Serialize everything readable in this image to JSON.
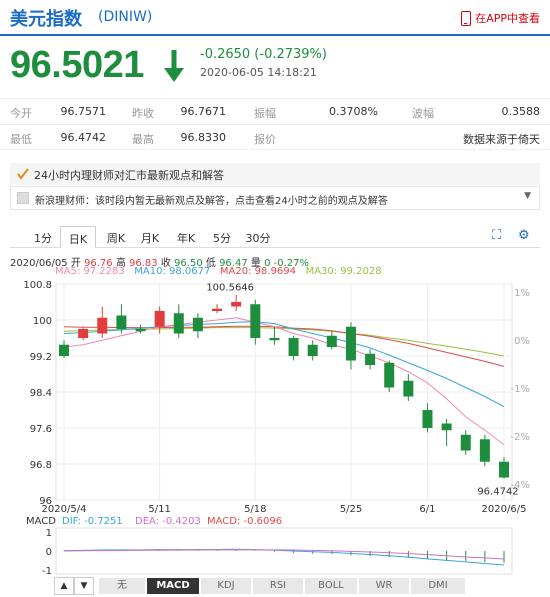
{
  "header": {
    "title": "美元指数",
    "code": "(DINIW)",
    "app_link": "在APP中查看"
  },
  "quote": {
    "price": "96.5021",
    "change": "-0.2650 (-0.2739%)",
    "time": "2020-06-05 14:18:21",
    "direction": "down",
    "color": "#1e8e3e"
  },
  "stats": {
    "rows": [
      [
        {
          "label": "今开",
          "value": "96.7571"
        },
        {
          "label": "昨收",
          "value": "96.7671"
        },
        {
          "label": "振幅",
          "value": "0.3708%"
        },
        {
          "label": "波幅",
          "value": "0.3588"
        }
      ],
      [
        {
          "label": "最低",
          "value": "96.4742"
        },
        {
          "label": "最高",
          "value": "96.8330"
        },
        {
          "label": "报价",
          "value": "数据来源于倚天"
        },
        {
          "label": "",
          "value": ""
        }
      ]
    ]
  },
  "info": {
    "title": "24小时内理财师对汇市最新观点和解答",
    "notice": "新浪理财师：该时段内暂无最新观点及解答，点击查看24小时之前的观点及解答"
  },
  "tabs": [
    "1分",
    "日K",
    "周K",
    "月K",
    "年K",
    "5分",
    "30分"
  ],
  "active_tab": "日K",
  "ohlc": {
    "date": "2020/06/05",
    "open_label": "开",
    "open": "96.76",
    "high_label": "高",
    "high": "96.83",
    "close_label": "收",
    "close": "96.50",
    "low_label": "低",
    "low": "96.47",
    "chg_label": "量",
    "chg": "0 -0.27%"
  },
  "ma": [
    {
      "label": "MA5: 97.2283",
      "color": "#f088b4"
    },
    {
      "label": "MA10: 98.0677",
      "color": "#3aa6d8"
    },
    {
      "label": "MA20: 98.9694",
      "color": "#e04a4a"
    },
    {
      "label": "MA30: 99.2028",
      "color": "#9ac23c"
    }
  ],
  "chart_data": {
    "type": "candlestick",
    "ylim": [
      96,
      100.8
    ],
    "y_ticks": [
      "100.8",
      "100",
      "99.2",
      "98.4",
      "97.6",
      "96.8",
      "96"
    ],
    "right_ticks": [
      "1%",
      "0%",
      "-1%",
      "-2%",
      "-4%"
    ],
    "x_labels": [
      {
        "index": 0,
        "label": "2020/5/4"
      },
      {
        "index": 5,
        "label": "5/11"
      },
      {
        "index": 10,
        "label": "5/18"
      },
      {
        "index": 15,
        "label": "5/25"
      },
      {
        "index": 19,
        "label": "6/1"
      },
      {
        "index": 23,
        "label": "2020/6/5"
      }
    ],
    "candles": [
      {
        "o": 99.45,
        "h": 99.55,
        "c": 99.2,
        "l": 99.15
      },
      {
        "o": 99.6,
        "h": 99.85,
        "c": 99.8,
        "l": 99.55
      },
      {
        "o": 99.7,
        "h": 100.3,
        "c": 100.05,
        "l": 99.6
      },
      {
        "o": 100.1,
        "h": 100.35,
        "c": 99.8,
        "l": 99.7
      },
      {
        "o": 99.8,
        "h": 99.9,
        "c": 99.75,
        "l": 99.7
      },
      {
        "o": 99.85,
        "h": 100.3,
        "c": 100.2,
        "l": 99.7
      },
      {
        "o": 100.15,
        "h": 100.35,
        "c": 99.7,
        "l": 99.6
      },
      {
        "o": 100.05,
        "h": 100.15,
        "c": 99.75,
        "l": 99.6
      },
      {
        "o": 100.2,
        "h": 100.35,
        "c": 100.25,
        "l": 100.15
      },
      {
        "o": 100.3,
        "h": 100.56,
        "c": 100.4,
        "l": 100.2
      },
      {
        "o": 100.35,
        "h": 100.45,
        "c": 99.6,
        "l": 99.45
      },
      {
        "o": 99.6,
        "h": 99.85,
        "c": 99.55,
        "l": 99.45
      },
      {
        "o": 99.6,
        "h": 99.65,
        "c": 99.2,
        "l": 99.1
      },
      {
        "o": 99.45,
        "h": 99.55,
        "c": 99.2,
        "l": 99.1
      },
      {
        "o": 99.65,
        "h": 99.75,
        "c": 99.4,
        "l": 99.35
      },
      {
        "o": 99.85,
        "h": 99.95,
        "c": 99.1,
        "l": 98.9
      },
      {
        "o": 99.25,
        "h": 99.35,
        "c": 99.0,
        "l": 98.9
      },
      {
        "o": 99.05,
        "h": 99.1,
        "c": 98.5,
        "l": 98.4
      },
      {
        "o": 98.65,
        "h": 98.8,
        "c": 98.3,
        "l": 98.2
      },
      {
        "o": 98.0,
        "h": 98.15,
        "c": 97.6,
        "l": 97.5
      },
      {
        "o": 97.7,
        "h": 97.8,
        "c": 97.55,
        "l": 97.2
      },
      {
        "o": 97.45,
        "h": 97.55,
        "c": 97.1,
        "l": 97.0
      },
      {
        "o": 97.35,
        "h": 97.45,
        "c": 96.85,
        "l": 96.75
      },
      {
        "o": 96.85,
        "h": 96.95,
        "c": 96.5,
        "l": 96.47
      }
    ],
    "annotations": [
      {
        "index": 9,
        "value": 100.5646,
        "label": "100.5646"
      },
      {
        "index": 23,
        "value": 96.4742,
        "label": "96.4742"
      }
    ],
    "ma5": [
      99.4,
      99.45,
      99.55,
      99.65,
      99.75,
      99.85,
      99.9,
      99.95,
      100.0,
      100.05,
      99.95,
      99.85,
      99.7,
      99.6,
      99.45,
      99.35,
      99.2,
      99.05,
      98.85,
      98.6,
      98.25,
      97.85,
      97.55,
      97.23
    ],
    "ma10": [
      99.7,
      99.72,
      99.75,
      99.78,
      99.82,
      99.85,
      99.88,
      99.9,
      99.92,
      99.95,
      99.96,
      99.92,
      99.8,
      99.7,
      99.6,
      99.5,
      99.38,
      99.22,
      99.05,
      98.88,
      98.7,
      98.5,
      98.3,
      98.07
    ],
    "ma20": [
      99.85,
      99.84,
      99.84,
      99.83,
      99.83,
      99.83,
      99.84,
      99.84,
      99.85,
      99.86,
      99.86,
      99.85,
      99.82,
      99.8,
      99.76,
      99.7,
      99.64,
      99.56,
      99.48,
      99.38,
      99.28,
      99.18,
      99.08,
      98.97
    ],
    "ma30": [
      99.75,
      99.76,
      99.78,
      99.79,
      99.8,
      99.8,
      99.81,
      99.82,
      99.83,
      99.83,
      99.83,
      99.82,
      99.8,
      99.78,
      99.75,
      99.7,
      99.66,
      99.6,
      99.55,
      99.48,
      99.42,
      99.35,
      99.28,
      99.2
    ],
    "macd_label": "MACD",
    "macd": {
      "dif_label": "DIF: -0.7251",
      "dea_label": "DEA: -0.4203",
      "macd_label": "MACD: -0.6096",
      "ticks": [
        "1",
        "0",
        "-1"
      ],
      "ylim": [
        -1.2,
        1.2
      ],
      "dif": [
        0.02,
        0.03,
        0.05,
        0.06,
        0.06,
        0.07,
        0.07,
        0.07,
        0.08,
        0.09,
        0.07,
        0.04,
        0.0,
        -0.04,
        -0.07,
        -0.13,
        -0.18,
        -0.25,
        -0.32,
        -0.41,
        -0.49,
        -0.57,
        -0.65,
        -0.73
      ],
      "dea": [
        0.0,
        0.01,
        0.02,
        0.03,
        0.04,
        0.04,
        0.05,
        0.05,
        0.06,
        0.06,
        0.06,
        0.06,
        0.05,
        0.03,
        0.01,
        -0.02,
        -0.05,
        -0.09,
        -0.14,
        -0.19,
        -0.25,
        -0.31,
        -0.36,
        -0.42
      ],
      "hist": [
        0.04,
        0.04,
        0.06,
        0.06,
        0.04,
        0.06,
        0.04,
        0.04,
        0.04,
        0.06,
        0.02,
        -0.04,
        -0.1,
        -0.14,
        -0.16,
        -0.22,
        -0.26,
        -0.32,
        -0.36,
        -0.44,
        -0.48,
        -0.52,
        -0.58,
        -0.61
      ]
    }
  },
  "indicators": [
    "无",
    "MACD",
    "KDJ",
    "RSI",
    "BOLL",
    "WR",
    "DMI"
  ],
  "active_indicator": "MACD",
  "colors": {
    "up": "#e23d3d",
    "down": "#1e8e3e",
    "accent": "#1a6cc4"
  }
}
